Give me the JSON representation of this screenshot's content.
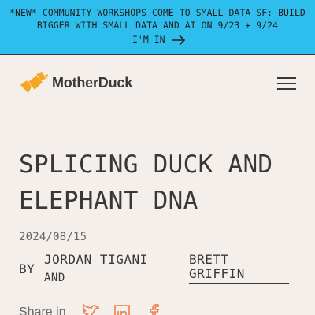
{
  "banner": {
    "text": "*NEW* COMMUNITY WORKSHOPS COME TO SMALL DATA SF: BUILD BIGGER WITH SMALL DATA AND AI ON 9/23 + 9/24",
    "cta_label": "I'M IN",
    "background": "#2ebeed"
  },
  "header": {
    "logo_text": "MotherDuck",
    "menu_icon": "hamburger-menu-icon"
  },
  "article": {
    "title": "SPLICING DUCK AND ELEPHANT DNA",
    "date": "2024/08/15",
    "by_label": "BY",
    "authors": [
      "JORDAN TIGANI",
      "BRETT GRIFFIN"
    ],
    "and_label": "AND",
    "share_label": "Share in",
    "share_icons": [
      "twitter-icon",
      "linkedin-icon",
      "facebook-icon"
    ]
  },
  "colors": {
    "page_background": "#f4efea",
    "text": "#383838",
    "accent_orange": "#f5a623"
  }
}
